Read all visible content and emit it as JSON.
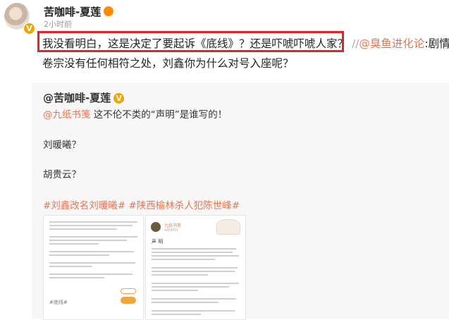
{
  "post": {
    "author": "苦咖啡-夏莲",
    "verified_badge": "V",
    "time": "2小时前",
    "line1_highlight": "我没看明白，这是决定了要起诉《底线》？还是吓唬吓唬人家？",
    "line1_sep": "//",
    "line1_mention": "@臭鱼进化论",
    "line1_rest": ":剧情和",
    "line2": "卷宗没有任何相符之处，刘鑫你为什么对号入座呢？"
  },
  "repost": {
    "author": "@苦咖啡-夏莲",
    "verified_badge": "V",
    "mention": "@九纸书笺",
    "text": " 这不伦不类的“声明”是谁写的！",
    "line_name1": "刘暖曦？",
    "line_name2": "胡贵云？",
    "tags": "#刘鑫改名刘暖曦# #陕西榆林杀人犯陈世峰#",
    "image2_title": "九纸书笺",
    "image2_subtitle": "4月30日",
    "image2_heading": "声 明",
    "image1_tag": "#底线#"
  },
  "colors": {
    "highlight_border": "#e0242a",
    "mention": "#eb7350",
    "badge": "#f0a500"
  },
  "icons": {
    "avatar": "user-avatar",
    "verified": "verified-badge-icon",
    "crown": "crown-icon"
  }
}
